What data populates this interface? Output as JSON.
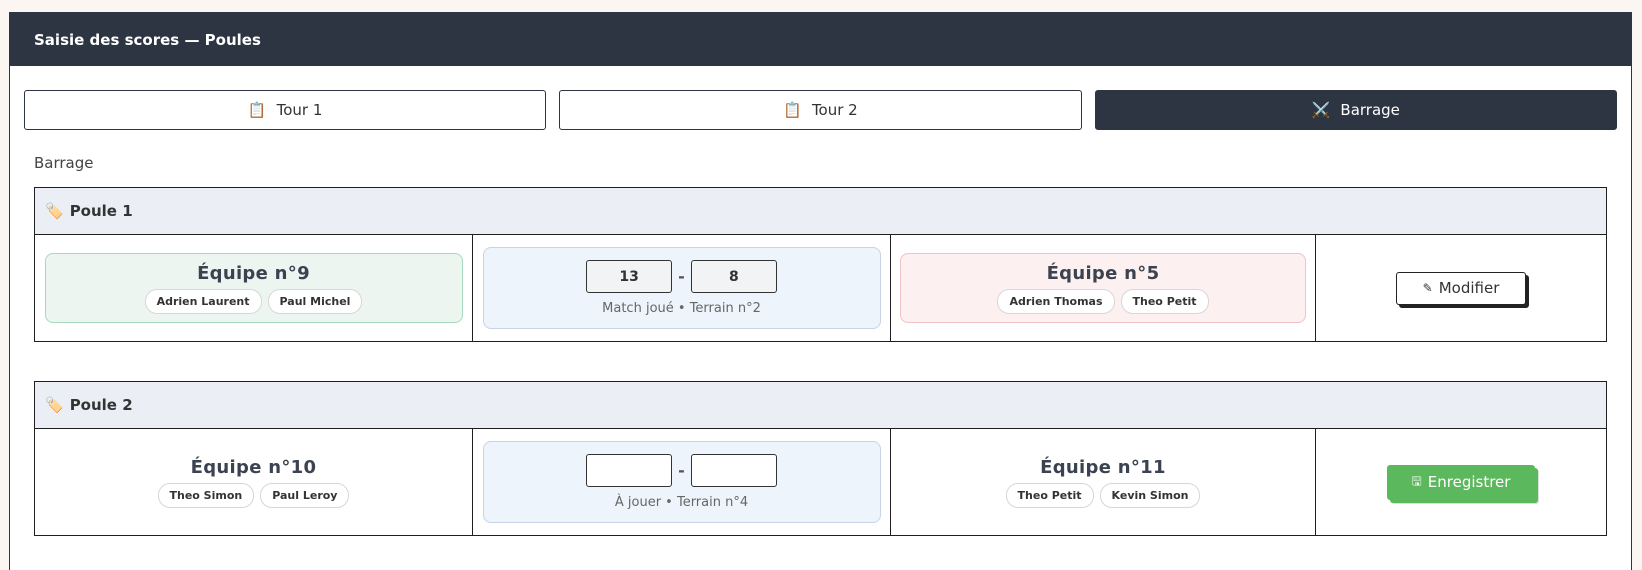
{
  "header": {
    "title": "Saisie des scores — Poules"
  },
  "tabs": [
    {
      "icon": "📋",
      "icon_name": "clipboard-icon",
      "label": "Tour 1",
      "active": false
    },
    {
      "icon": "📋",
      "icon_name": "clipboard-icon",
      "label": "Tour 2",
      "active": false
    },
    {
      "icon": "⚔️",
      "icon_name": "crossed-swords-icon",
      "label": "Barrage",
      "active": true
    }
  ],
  "section_title": "Barrage",
  "poules": [
    {
      "icon": "🏷️",
      "name": "Poule 1",
      "team_a": {
        "name": "Équipe n°9",
        "players": [
          "Adrien Laurent",
          "Paul Michel"
        ],
        "status": "win"
      },
      "score_a": "13",
      "score_b": "8",
      "separator": "-",
      "info": "Match joué • Terrain n°2",
      "team_b": {
        "name": "Équipe n°5",
        "players": [
          "Adrien Thomas",
          "Theo Petit"
        ],
        "status": "lose"
      },
      "action": {
        "icon": "✎",
        "label": "Modifier"
      }
    },
    {
      "icon": "🏷️",
      "name": "Poule 2",
      "team_a": {
        "name": "Équipe n°10",
        "players": [
          "Theo Simon",
          "Paul Leroy"
        ],
        "status": "neutral"
      },
      "score_a": "",
      "score_b": "",
      "separator": "-",
      "info": "À jouer • Terrain n°4",
      "team_b": {
        "name": "Équipe n°11",
        "players": [
          "Theo Petit",
          "Kevin Simon"
        ],
        "status": "neutral"
      },
      "action": {
        "icon": "🖫",
        "label": "Enregistrer"
      }
    }
  ],
  "colors": {
    "header_bg": "#2d3542",
    "win_bg": "#ecf5f0",
    "lose_bg": "#fdf0f0",
    "score_bg": "#edf4fc",
    "save_green": "#5cb85c"
  }
}
